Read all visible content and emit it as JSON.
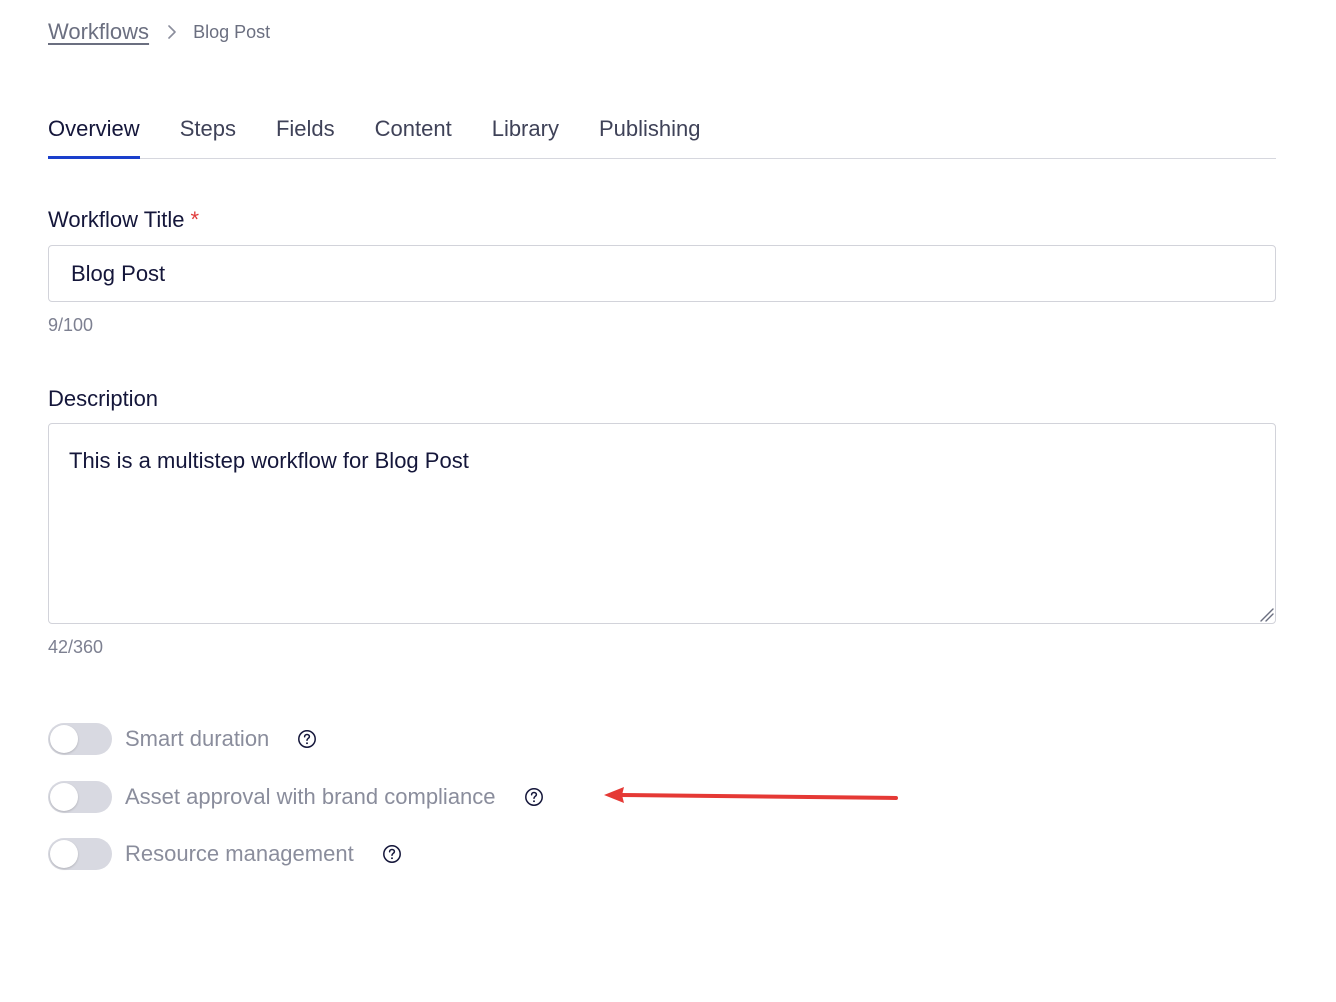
{
  "breadcrumb": {
    "root": "Workflows",
    "current": "Blog Post"
  },
  "tabs": [
    {
      "label": "Overview",
      "active": true
    },
    {
      "label": "Steps",
      "active": false
    },
    {
      "label": "Fields",
      "active": false
    },
    {
      "label": "Content",
      "active": false
    },
    {
      "label": "Library",
      "active": false
    },
    {
      "label": "Publishing",
      "active": false
    }
  ],
  "form": {
    "title_label": "Workflow Title",
    "required_mark": "*",
    "title_value": "Blog Post",
    "title_counter": "9/100",
    "description_label": "Description",
    "description_value": "This is a multistep workflow for Blog Post",
    "description_counter": "42/360"
  },
  "toggles": [
    {
      "label": "Smart duration",
      "enabled": false
    },
    {
      "label": "Asset approval with brand compliance",
      "enabled": false
    },
    {
      "label": "Resource management",
      "enabled": false
    }
  ],
  "colors": {
    "accent": "#1a3fcc",
    "required": "#e03a3a",
    "annotation_arrow": "#e53935",
    "toggle_off": "#d8d9e1"
  },
  "icons": {
    "breadcrumb_separator": "chevron-right-icon",
    "toggle_help": "question-circle-icon",
    "annotation": "red-arrow-annotation"
  }
}
